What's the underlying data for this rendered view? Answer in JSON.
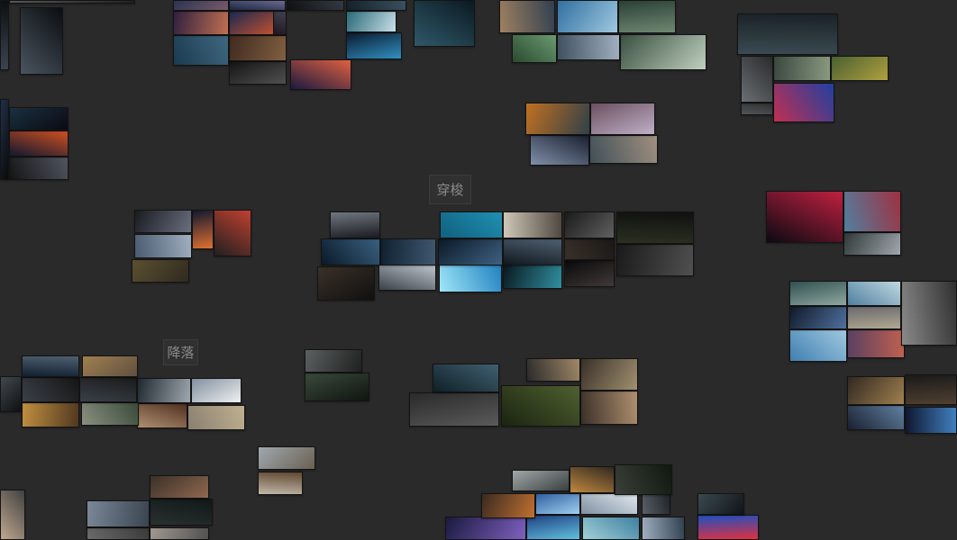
{
  "canvas": {
    "background": "#2a2a2a"
  },
  "labels": {
    "shuttle": "穿梭",
    "landing": "降落"
  }
}
